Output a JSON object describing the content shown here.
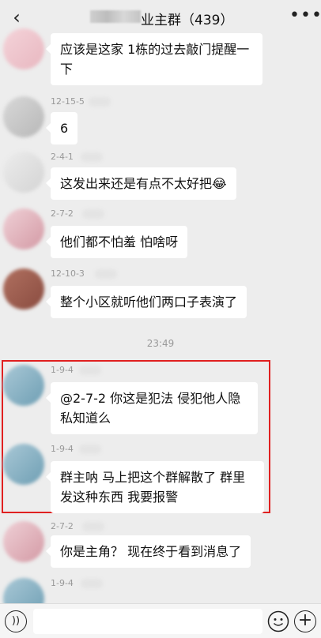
{
  "header": {
    "title": "业主群（439）",
    "back_icon": "chevron-left-icon",
    "more_icon": "more-icon"
  },
  "timestamp": "23:49",
  "messages": [
    {
      "meta": "",
      "text": "应该是这家 1栋的过去敲门提醒一下",
      "avatar_color": "#f0c8cf"
    },
    {
      "meta": "12-15-5",
      "text": "6",
      "avatar_color": "#c8c8c8"
    },
    {
      "meta": "2-4-1",
      "text": "这发出来还是有点不太好把😂",
      "avatar_color": "#e0e0e0"
    },
    {
      "meta": "2-7-2",
      "text": "他们都不怕羞 怕啥呀",
      "avatar_color": "#e3b7bf"
    },
    {
      "meta": "12-10-3",
      "text": "整个小区就听他们两口子表演了",
      "avatar_color": "#9c5c4c"
    },
    {
      "meta": "1-9-4",
      "text": "@2-7-2 你这是犯法 侵犯他人隐私知道么",
      "avatar_color": "#8fb3c3"
    },
    {
      "meta": "1-9-4",
      "text": "群主呐 马上把这个群解散了 群里发这种东西 我要报警",
      "avatar_color": "#8fb3c3"
    },
    {
      "meta": "2-7-2",
      "text": "你是主角？ 现在终于看到消息了",
      "avatar_color": "#e3b7bf"
    },
    {
      "meta": "1-9-4",
      "text": "",
      "avatar_color": "#8fb3c3"
    }
  ],
  "input_bar": {
    "voice_icon": "voice-icon",
    "emoji_icon": "emoji-icon",
    "plus_icon": "plus-icon"
  },
  "colors": {
    "highlight": "#e02020",
    "background": "#ededed"
  }
}
